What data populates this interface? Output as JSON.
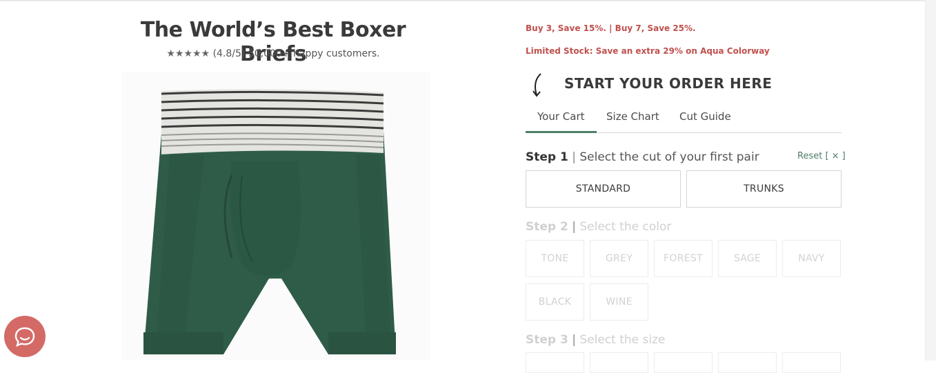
{
  "product": {
    "title": "The World’s Best Boxer Briefs",
    "stars": "★★★★★",
    "rating": "(4.8/5)",
    "customers": "50,000+ happy customers.",
    "image_color": "#2f5c48"
  },
  "promos": {
    "line1": "Buy 3, Save 15%. | Buy 7, Save 25%.",
    "line2": "Limited Stock: Save an extra 29% on Aqua Colorway"
  },
  "order": {
    "heading": "START YOUR ORDER HERE",
    "tabs": [
      {
        "label": "Your Cart",
        "active": true
      },
      {
        "label": "Size Chart",
        "active": false
      },
      {
        "label": "Cut Guide",
        "active": false
      }
    ],
    "reset_label": "Reset [ × ]",
    "steps": [
      {
        "number": "Step 1",
        "separator": "|",
        "desc": "Select the cut of your first pair"
      },
      {
        "number": "Step 2",
        "separator": "|",
        "desc": "Select the color"
      },
      {
        "number": "Step 3",
        "separator": "|",
        "desc": "Select the size"
      }
    ],
    "cuts": [
      "STANDARD",
      "TRUNKS"
    ],
    "colors": [
      "TONE",
      "GREY",
      "FOREST",
      "SAGE",
      "NAVY",
      "BLACK",
      "WINE"
    ]
  },
  "colors": {
    "accent": "#4e7d68",
    "promo": "#c0504d",
    "chat": "#d46a66"
  },
  "chat": {
    "icon": "chat-icon"
  }
}
